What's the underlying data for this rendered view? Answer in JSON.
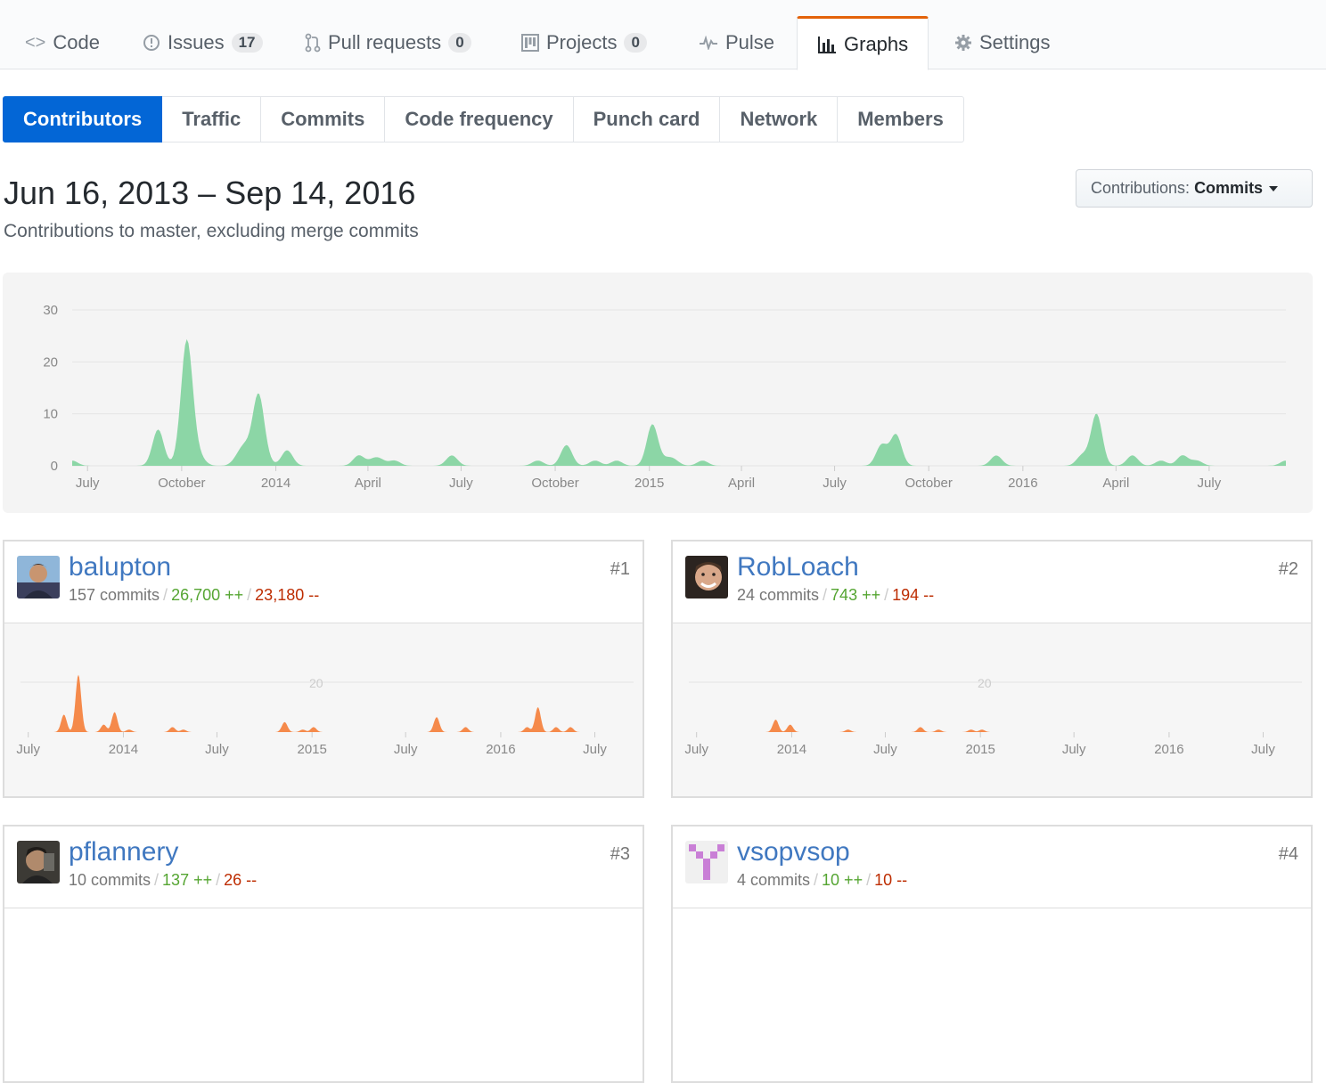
{
  "reponav": {
    "items": [
      {
        "label": "Code",
        "icon": "code-icon",
        "counter": null
      },
      {
        "label": "Issues",
        "icon": "issue-icon",
        "counter": "17"
      },
      {
        "label": "Pull requests",
        "icon": "pull-request-icon",
        "counter": "0"
      },
      {
        "label": "Projects",
        "icon": "project-icon",
        "counter": "0"
      },
      {
        "label": "Pulse",
        "icon": "pulse-icon",
        "counter": null
      },
      {
        "label": "Graphs",
        "icon": "graph-icon",
        "counter": null,
        "selected": true
      },
      {
        "label": "Settings",
        "icon": "gear-icon",
        "counter": null
      }
    ]
  },
  "subnav": {
    "items": [
      "Contributors",
      "Traffic",
      "Commits",
      "Code frequency",
      "Punch card",
      "Network",
      "Members"
    ],
    "selected": "Contributors"
  },
  "header": {
    "date_range": "Jun 16, 2013 – Sep 14, 2016",
    "subtitle": "Contributions to master, excluding merge commits",
    "select_prefix": "Contributions:",
    "select_value": "Commits"
  },
  "colors": {
    "accent_blue": "#0366d6",
    "selected_tab_border": "#e36209",
    "main_chart_fill": "#8cd6a6",
    "contributor_chart_fill": "#f58a4b",
    "additions": "#55a532",
    "deletions": "#bd2c00",
    "link": "#4078c0"
  },
  "chart_data": [
    {
      "type": "area",
      "title": "",
      "xlabel": "",
      "ylabel": "",
      "ylim": [
        0,
        30
      ],
      "y_ticks": [
        "0",
        "10",
        "20",
        "30"
      ],
      "x_tick_labels": [
        "July",
        "October",
        "2014",
        "April",
        "July",
        "October",
        "2015",
        "April",
        "July",
        "October",
        "2016",
        "April",
        "July"
      ],
      "x": [
        "2013-06-16",
        "2013-06-23",
        "2013-07-07",
        "2013-08-04",
        "2013-09-01",
        "2013-09-08",
        "2013-09-15",
        "2013-09-29",
        "2013-10-06",
        "2013-10-13",
        "2013-10-20",
        "2013-10-27",
        "2013-11-10",
        "2013-11-24",
        "2013-12-01",
        "2013-12-08",
        "2013-12-15",
        "2013-12-22",
        "2014-01-05",
        "2014-01-12",
        "2014-01-19",
        "2014-02-09",
        "2014-03-09",
        "2014-03-23",
        "2014-04-06",
        "2014-04-13",
        "2014-04-20",
        "2014-04-27",
        "2014-05-04",
        "2014-05-18",
        "2014-06-08",
        "2014-06-22",
        "2014-09-07",
        "2014-09-14",
        "2014-09-28",
        "2014-10-12",
        "2014-11-09",
        "2014-11-16",
        "2014-11-30",
        "2014-12-14",
        "2014-12-28",
        "2015-01-04",
        "2015-01-18",
        "2015-01-25",
        "2015-02-08",
        "2015-02-22",
        "2015-08-02",
        "2015-08-16",
        "2015-08-30",
        "2015-09-13",
        "2015-11-29",
        "2015-12-06",
        "2015-12-20",
        "2016-02-21",
        "2016-02-28",
        "2016-03-13",
        "2016-03-20",
        "2016-04-03",
        "2016-04-17",
        "2016-05-01",
        "2016-05-15",
        "2016-06-05",
        "2016-06-19",
        "2016-07-10",
        "2016-09-04",
        "2016-09-14"
      ],
      "y": [
        1,
        0,
        0,
        0,
        0,
        7,
        0,
        1,
        23,
        2,
        1,
        0,
        0,
        1,
        3,
        1,
        13,
        1,
        0,
        3,
        0,
        0,
        0,
        2,
        1,
        1,
        0,
        1,
        0,
        0,
        0,
        2,
        0,
        1,
        0,
        4,
        1,
        0,
        1,
        0,
        0,
        8,
        1,
        1,
        0,
        1,
        0,
        4,
        6,
        0,
        0,
        2,
        0,
        0,
        2,
        10,
        0,
        0,
        2,
        0,
        1,
        2,
        1,
        0,
        0,
        1
      ]
    },
    {
      "type": "area",
      "series": [
        {
          "name": "balupton"
        }
      ],
      "y_ticks": [
        "20"
      ],
      "x_tick_labels": [
        "July",
        "2014",
        "July",
        "2015",
        "July",
        "2016",
        "July"
      ],
      "x": [
        "2013-09-08",
        "2013-10-06",
        "2013-11-24",
        "2013-12-15",
        "2014-01-12",
        "2014-04-06",
        "2014-04-27",
        "2014-11-09",
        "2014-12-14",
        "2015-01-04",
        "2015-08-30",
        "2015-10-25",
        "2016-02-21",
        "2016-03-13",
        "2016-04-17",
        "2016-05-15"
      ],
      "y": [
        7,
        23,
        3,
        8,
        1,
        2,
        1,
        4,
        1,
        2,
        6,
        2,
        2,
        10,
        2,
        2
      ]
    },
    {
      "type": "area",
      "series": [
        {
          "name": "RobLoach"
        }
      ],
      "y_ticks": [
        "20"
      ],
      "x_tick_labels": [
        "July",
        "2014",
        "July",
        "2015",
        "July",
        "2016",
        "July"
      ],
      "x": [
        "2013-12-01",
        "2013-12-29",
        "2014-04-20",
        "2014-09-07",
        "2014-10-12",
        "2014-12-14",
        "2015-01-04"
      ],
      "y": [
        5,
        3,
        1,
        2,
        1,
        1,
        1
      ]
    }
  ],
  "contributors": [
    {
      "login": "balupton",
      "commits": "157 commits",
      "additions": "26,700 ++",
      "deletions": "23,180 --",
      "rank": "#1"
    },
    {
      "login": "RobLoach",
      "commits": "24 commits",
      "additions": "743 ++",
      "deletions": "194 --",
      "rank": "#2"
    },
    {
      "login": "pflannery",
      "commits": "10 commits",
      "additions": "137 ++",
      "deletions": "26 --",
      "rank": "#3"
    },
    {
      "login": "vsopvsop",
      "commits": "4 commits",
      "additions": "10 ++",
      "deletions": "10 --",
      "rank": "#4"
    }
  ]
}
